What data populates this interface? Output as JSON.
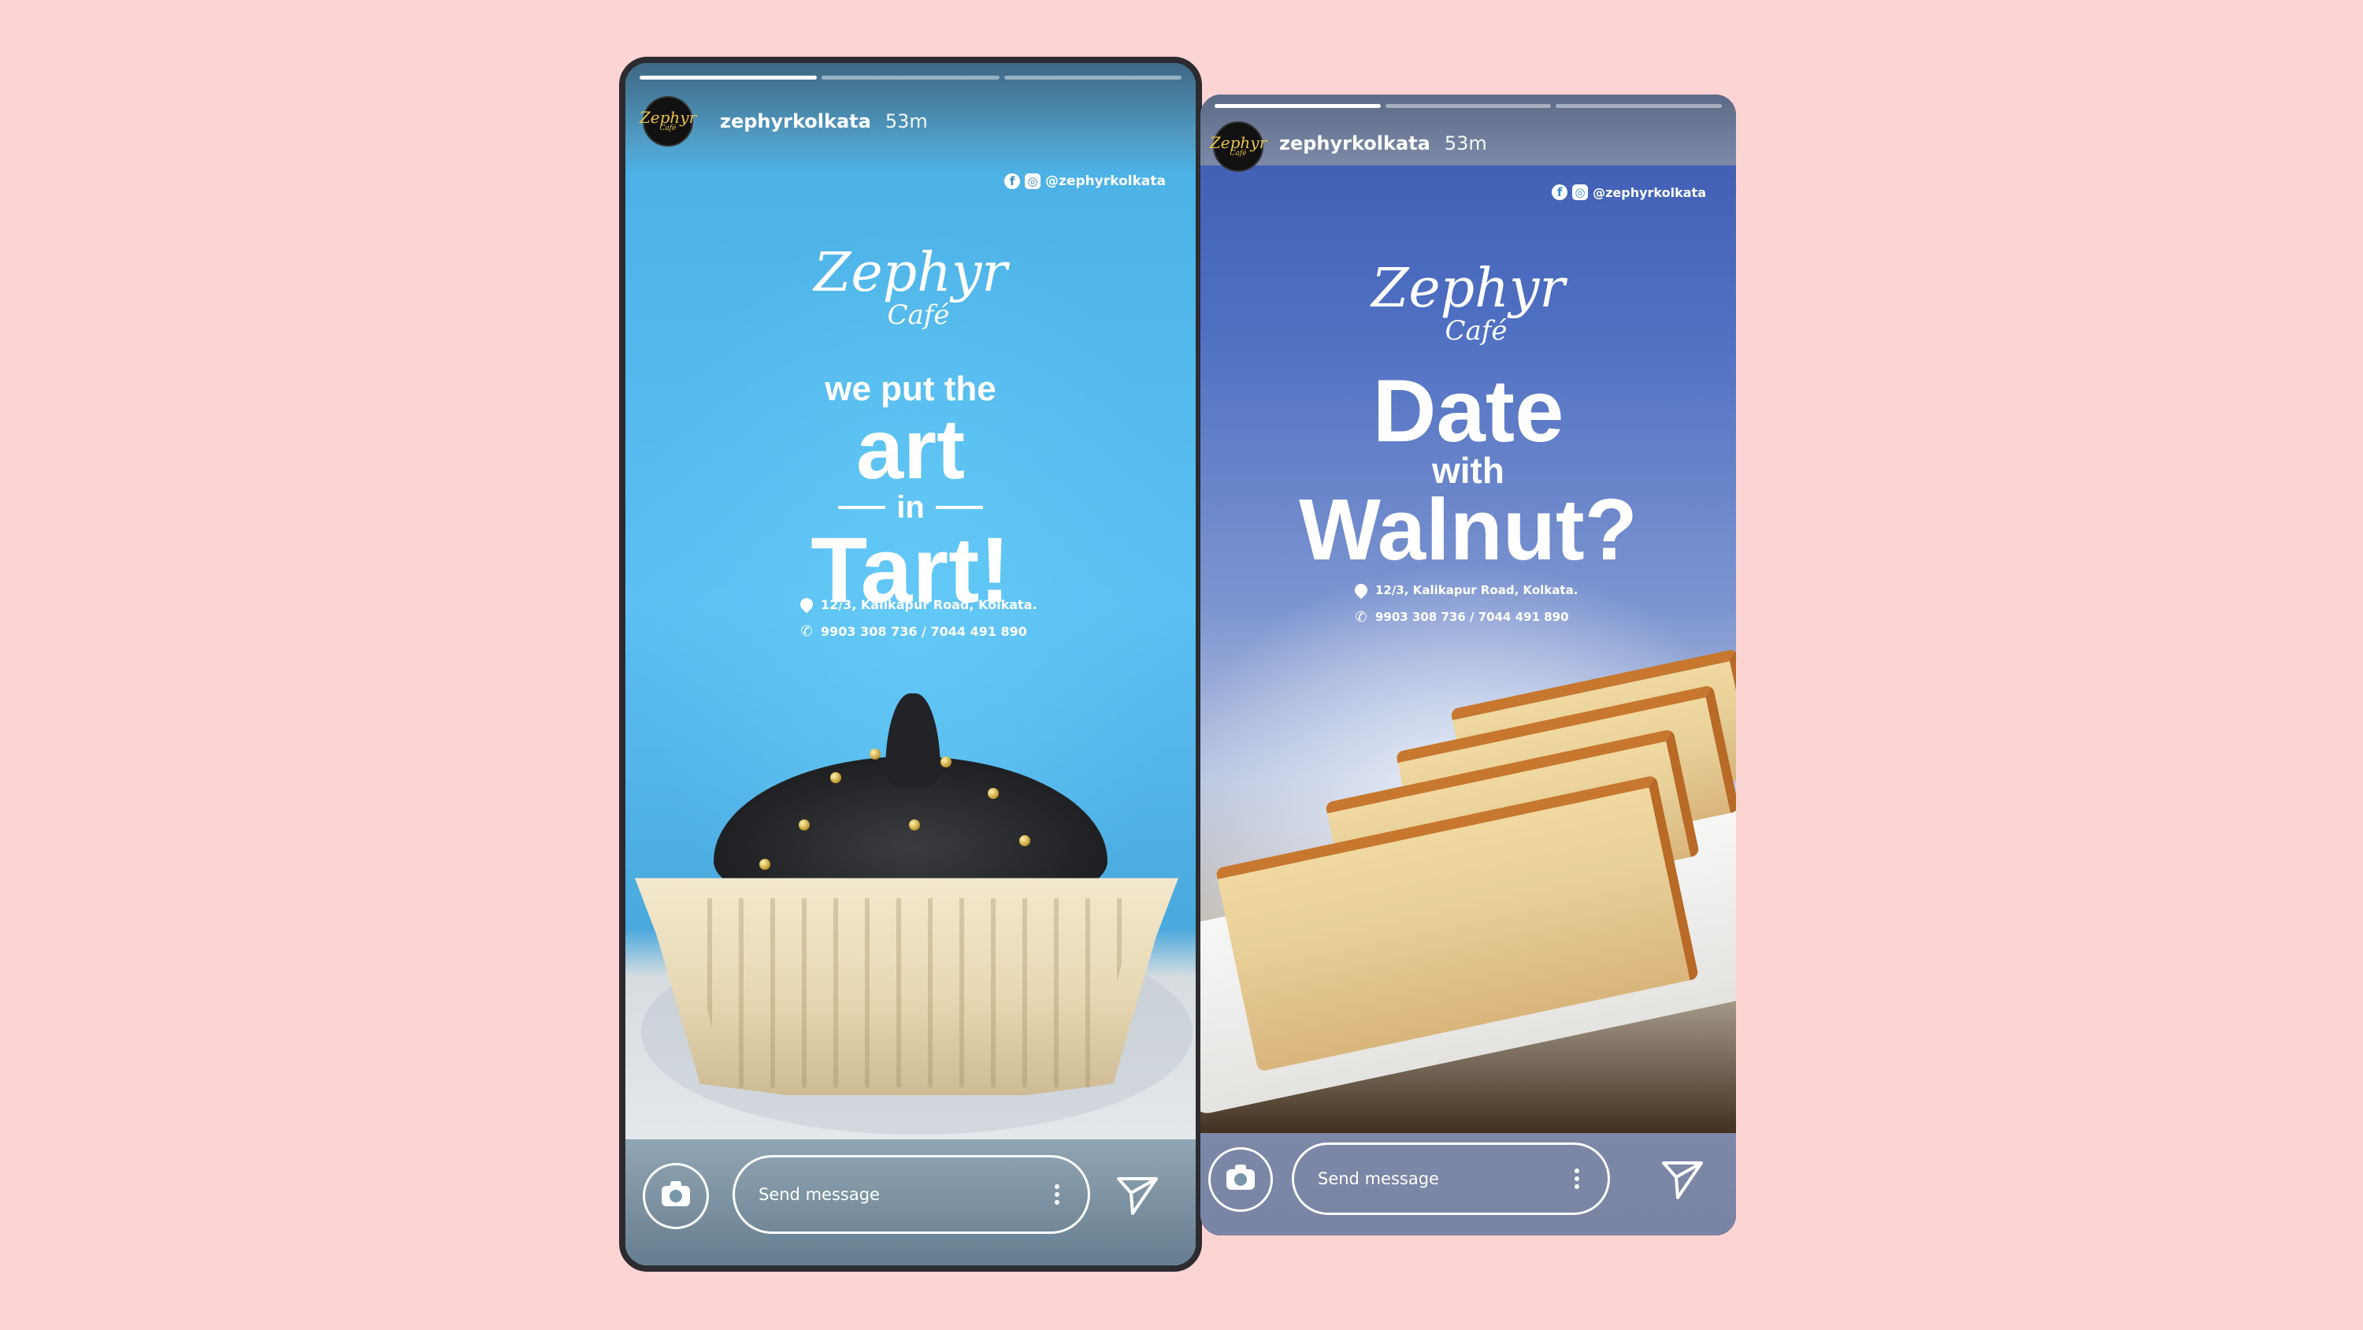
{
  "stories": [
    {
      "username": "zephyrkolkata",
      "time": "53m",
      "avatar_text": "Zephyr",
      "avatar_sub": "Café",
      "social_handle": "@zephyrkolkata",
      "brand_name": "Zephyr",
      "brand_sub": "Café",
      "headline": [
        "we put the",
        "art",
        "in",
        "Tart!"
      ],
      "address": "12/3, Kalikapur Road, Kolkata.",
      "phone": "9903 308 736 / 7044 491 890",
      "message_placeholder": "Send message",
      "progress_done": 1,
      "progress_total": 3
    },
    {
      "username": "zephyrkolkata",
      "time": "53m",
      "avatar_text": "Zephyr",
      "avatar_sub": "Café",
      "social_handle": "@zephyrkolkata",
      "brand_name": "Zephyr",
      "brand_sub": "Café",
      "headline": [
        "Date",
        "with",
        "Walnut?"
      ],
      "address": "12/3, Kalikapur Road, Kolkata.",
      "phone": "9903 308 736 / 7044 491 890",
      "message_placeholder": "Send message",
      "progress_done": 1,
      "progress_total": 3
    }
  ],
  "icons": {
    "facebook": "facebook-icon",
    "instagram": "instagram-icon",
    "location": "location-pin-icon",
    "phone": "phone-icon",
    "camera": "camera-icon",
    "more": "more-vertical-icon",
    "send": "send-icon"
  },
  "colors": {
    "background": "#fdd4d4",
    "story1_sky": "#4fb2e8",
    "story2_sky": "#4e6fc2",
    "frame": "#2c2c30"
  }
}
